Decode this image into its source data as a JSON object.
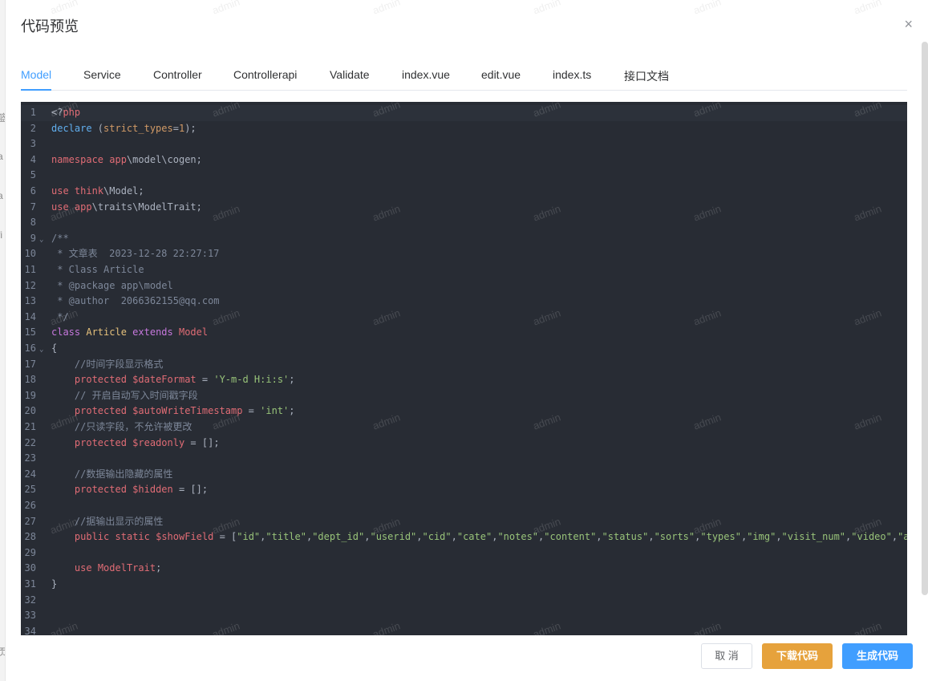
{
  "left_strip_chars": [
    "篮",
    "a",
    "a",
    "fi",
    "页"
  ],
  "dialog": {
    "title": "代码预览",
    "close_glyph": "×"
  },
  "tabs": [
    "Model",
    "Service",
    "Controller",
    "Controllerapi",
    "Validate",
    "index.vue",
    "edit.vue",
    "index.ts",
    "接口文档"
  ],
  "active_tab": "Model",
  "code_lines": [
    {
      "n": "1",
      "fold": false,
      "tokens": [
        [
          "",
          "<?"
        ],
        [
          "red",
          "php"
        ]
      ]
    },
    {
      "n": "2",
      "fold": false,
      "tokens": [
        [
          "fn",
          "declare"
        ],
        [
          "",
          " ("
        ],
        [
          "num",
          "strict_types"
        ],
        [
          "",
          "="
        ],
        [
          "num",
          "1"
        ],
        [
          "",
          ");"
        ]
      ]
    },
    {
      "n": "3",
      "fold": false,
      "tokens": []
    },
    {
      "n": "4",
      "fold": false,
      "tokens": [
        [
          "red",
          "namespace"
        ],
        [
          "",
          " "
        ],
        [
          "red",
          "app"
        ],
        [
          "",
          "\\model\\cogen;"
        ]
      ]
    },
    {
      "n": "5",
      "fold": false,
      "tokens": []
    },
    {
      "n": "6",
      "fold": false,
      "tokens": [
        [
          "red",
          "use"
        ],
        [
          "",
          " "
        ],
        [
          "red",
          "think"
        ],
        [
          "",
          "\\Model;"
        ]
      ]
    },
    {
      "n": "7",
      "fold": false,
      "tokens": [
        [
          "red",
          "use"
        ],
        [
          "",
          " "
        ],
        [
          "red",
          "app"
        ],
        [
          "",
          "\\traits\\ModelTrait;"
        ]
      ]
    },
    {
      "n": "8",
      "fold": false,
      "tokens": []
    },
    {
      "n": "9",
      "fold": true,
      "tokens": [
        [
          "cmt",
          "/**"
        ]
      ]
    },
    {
      "n": "10",
      "fold": false,
      "tokens": [
        [
          "cmt",
          " * 文章表  2023-12-28 22:27:17"
        ]
      ]
    },
    {
      "n": "11",
      "fold": false,
      "tokens": [
        [
          "cmt",
          " * Class Article"
        ]
      ]
    },
    {
      "n": "12",
      "fold": false,
      "tokens": [
        [
          "cmt",
          " * @package app\\model"
        ]
      ]
    },
    {
      "n": "13",
      "fold": false,
      "tokens": [
        [
          "cmt",
          " * @author  2066362155@qq.com"
        ]
      ]
    },
    {
      "n": "14",
      "fold": false,
      "tokens": [
        [
          "cmt",
          " */"
        ]
      ]
    },
    {
      "n": "15",
      "fold": false,
      "tokens": [
        [
          "kw",
          "class"
        ],
        [
          "",
          " "
        ],
        [
          "cls",
          "Article"
        ],
        [
          "",
          " "
        ],
        [
          "kw",
          "extends"
        ],
        [
          "",
          " "
        ],
        [
          "red",
          "Model"
        ]
      ]
    },
    {
      "n": "16",
      "fold": true,
      "tokens": [
        [
          "",
          "{"
        ]
      ]
    },
    {
      "n": "17",
      "fold": false,
      "tokens": [
        [
          "cmt",
          "    //时间字段显示格式"
        ]
      ]
    },
    {
      "n": "18",
      "fold": false,
      "tokens": [
        [
          "",
          "    "
        ],
        [
          "red",
          "protected"
        ],
        [
          "",
          " "
        ],
        [
          "red",
          "$dateFormat"
        ],
        [
          "",
          " = "
        ],
        [
          "str",
          "'Y-m-d H:i:s'"
        ],
        [
          "",
          ";"
        ]
      ]
    },
    {
      "n": "19",
      "fold": false,
      "tokens": [
        [
          "cmt",
          "    // 开启自动写入时间戳字段"
        ]
      ]
    },
    {
      "n": "20",
      "fold": false,
      "tokens": [
        [
          "",
          "    "
        ],
        [
          "red",
          "protected"
        ],
        [
          "",
          " "
        ],
        [
          "red",
          "$autoWriteTimestamp"
        ],
        [
          "",
          " = "
        ],
        [
          "str",
          "'int'"
        ],
        [
          "",
          ";"
        ]
      ]
    },
    {
      "n": "21",
      "fold": false,
      "tokens": [
        [
          "cmt",
          "    //只读字段，不允许被更改"
        ]
      ]
    },
    {
      "n": "22",
      "fold": false,
      "tokens": [
        [
          "",
          "    "
        ],
        [
          "red",
          "protected"
        ],
        [
          "",
          " "
        ],
        [
          "red",
          "$readonly"
        ],
        [
          "",
          " = [];"
        ]
      ]
    },
    {
      "n": "23",
      "fold": false,
      "tokens": []
    },
    {
      "n": "24",
      "fold": false,
      "tokens": [
        [
          "cmt",
          "    //数据输出隐藏的属性"
        ]
      ]
    },
    {
      "n": "25",
      "fold": false,
      "tokens": [
        [
          "",
          "    "
        ],
        [
          "red",
          "protected"
        ],
        [
          "",
          " "
        ],
        [
          "red",
          "$hidden"
        ],
        [
          "",
          " = [];"
        ]
      ]
    },
    {
      "n": "26",
      "fold": false,
      "tokens": []
    },
    {
      "n": "27",
      "fold": false,
      "tokens": [
        [
          "cmt",
          "    //据输出显示的属性"
        ]
      ]
    },
    {
      "n": "28",
      "fold": false,
      "tokens": [
        [
          "",
          "    "
        ],
        [
          "red",
          "public"
        ],
        [
          "",
          " "
        ],
        [
          "red",
          "static"
        ],
        [
          "",
          " "
        ],
        [
          "red",
          "$showField"
        ],
        [
          "",
          " = ["
        ],
        [
          "str",
          "\"id\""
        ],
        [
          "",
          ","
        ],
        [
          "str",
          "\"title\""
        ],
        [
          "",
          ","
        ],
        [
          "str",
          "\"dept_id\""
        ],
        [
          "",
          ","
        ],
        [
          "str",
          "\"userid\""
        ],
        [
          "",
          ","
        ],
        [
          "str",
          "\"cid\""
        ],
        [
          "",
          ","
        ],
        [
          "str",
          "\"cate\""
        ],
        [
          "",
          ","
        ],
        [
          "str",
          "\"notes\""
        ],
        [
          "",
          ","
        ],
        [
          "str",
          "\"content\""
        ],
        [
          "",
          ","
        ],
        [
          "str",
          "\"status\""
        ],
        [
          "",
          ","
        ],
        [
          "str",
          "\"sorts\""
        ],
        [
          "",
          ","
        ],
        [
          "str",
          "\"types\""
        ],
        [
          "",
          ","
        ],
        [
          "str",
          "\"img\""
        ],
        [
          "",
          ","
        ],
        [
          "str",
          "\"visit_num\""
        ],
        [
          "",
          ","
        ],
        [
          "str",
          "\"video\""
        ],
        [
          "",
          ","
        ],
        [
          "str",
          "\"author\""
        ]
      ]
    },
    {
      "n": "29",
      "fold": false,
      "tokens": []
    },
    {
      "n": "30",
      "fold": false,
      "tokens": [
        [
          "",
          "    "
        ],
        [
          "red",
          "use"
        ],
        [
          "",
          " "
        ],
        [
          "red",
          "ModelTrait"
        ],
        [
          "",
          ";"
        ]
      ]
    },
    {
      "n": "31",
      "fold": false,
      "tokens": [
        [
          "",
          "}"
        ]
      ]
    },
    {
      "n": "32",
      "fold": false,
      "tokens": []
    },
    {
      "n": "33",
      "fold": false,
      "tokens": []
    },
    {
      "n": "34",
      "fold": false,
      "tokens": []
    }
  ],
  "watermark_text": "admin",
  "footer": {
    "cancel": "取 消",
    "download": "下载代码",
    "generate": "生成代码"
  },
  "colors": {
    "accent": "#409eff",
    "warning": "#e6a23c",
    "editor_bg": "#282c34"
  }
}
